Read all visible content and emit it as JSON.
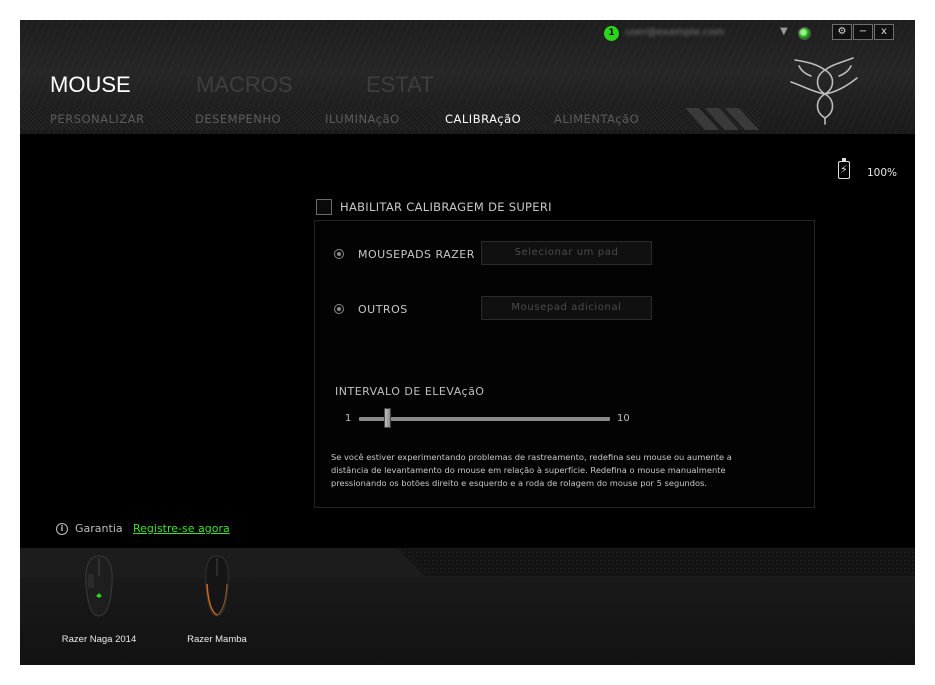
{
  "topbar": {
    "notification_count": "1",
    "account": "user@example.com",
    "dropdown_glyph": "▼",
    "buttons": [
      "⚙",
      "−",
      "x"
    ]
  },
  "main_tabs": [
    "MOUSE",
    "MACROS",
    "ESTAT"
  ],
  "sub_tabs": [
    "PERSONALIZAR",
    "DESEMPENHO",
    "ILUMINAçãO",
    "CALIBRAçãO",
    "ALIMENTAçãO"
  ],
  "active_sub_tab": "CALIBRAçãO",
  "battery": {
    "percent_text": "100%",
    "level": 100
  },
  "calibration": {
    "enable_label": "HABILITAR CALIBRAGEM DE SUPERI",
    "enabled": false,
    "options": [
      {
        "label": "MOUSEPADS RAZER",
        "button": "Selecionar um pad"
      },
      {
        "label": "OUTROS",
        "button": "Mousepad adicional"
      }
    ],
    "lift_range": {
      "title": "INTERVALO DE ELEVAçãO",
      "min": 1,
      "max": 10,
      "value": 2
    },
    "help_lines": [
      "Se você estiver experimentando problemas de rastreamento, redefina seu mouse ou aumente a",
      "distância de levantamento do mouse em relação à superfície. Redefina o mouse manualmente",
      "pressionando os botões direito e esquerdo e a roda de rolagem do mouse por 5 segundos."
    ]
  },
  "warranty": {
    "label": "Garantia",
    "link": "Registre-se agora"
  },
  "devices": [
    {
      "name": "Razer Naga 2014",
      "accent": "#2ad51c"
    },
    {
      "name": "Razer Mamba",
      "accent": "#d2691e"
    }
  ],
  "colors": {
    "accent": "#2ad51c",
    "link": "#3ee02c"
  }
}
